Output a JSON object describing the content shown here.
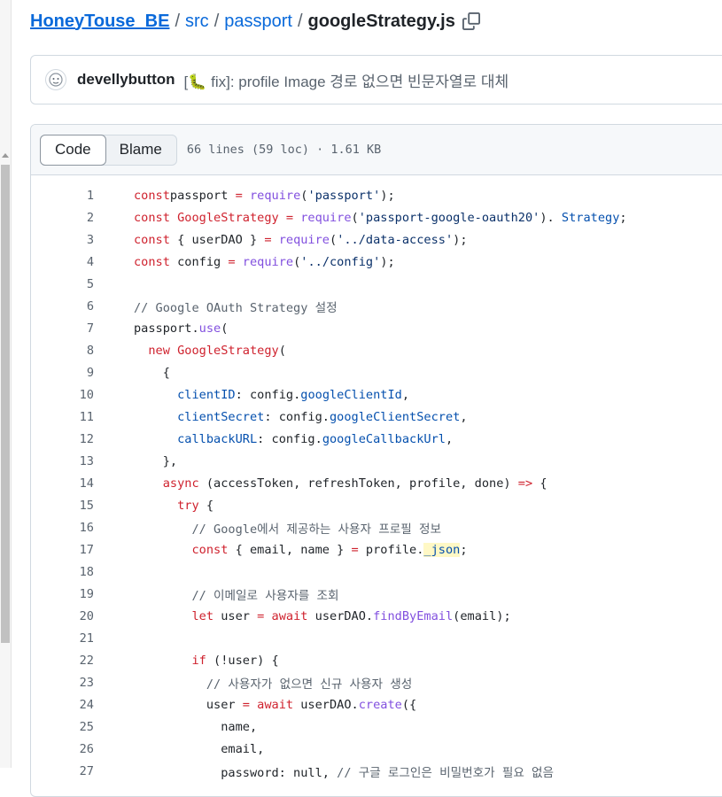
{
  "breadcrumb": {
    "repo": "HoneyTouse_BE",
    "dir1": "src",
    "dir2": "passport",
    "file": "googleStrategy.js",
    "separator": "/"
  },
  "commit": {
    "author": "develly­button",
    "message": "[🐛 fix]: profile Image 경로 없으면 빈문자열로 대체"
  },
  "file_header": {
    "tabs": [
      "Code",
      "Blame"
    ],
    "active_tab": "Code",
    "meta": "66 lines (59 loc) · 1.61 KB"
  },
  "code_lines": [
    {
      "n": "1",
      "tokens": [
        [
          "kw",
          "const"
        ],
        [
          "",
          "passport "
        ],
        [
          "kw",
          "="
        ],
        [
          "",
          ""
        ],
        [
          "fn",
          " require"
        ],
        [
          "",
          "("
        ],
        [
          "str",
          "'passport'"
        ],
        [
          "",
          ");"
        ]
      ]
    },
    {
      "n": "2",
      "tokens": [
        [
          "kw",
          "const"
        ],
        [
          "kw",
          " GoogleStrategy"
        ],
        [
          "",
          ""
        ],
        [
          "kw",
          " ="
        ],
        [
          "fn",
          " require"
        ],
        [
          "",
          "("
        ],
        [
          "str",
          "'passport-google-oauth20'"
        ],
        [
          "",
          "). "
        ],
        [
          "prop",
          "Strategy"
        ],
        [
          "",
          ";"
        ]
      ]
    },
    {
      "n": "3",
      "tokens": [
        [
          "kw",
          "const"
        ],
        [
          "",
          " { userDAO } "
        ],
        [
          "kw",
          "="
        ],
        [
          "fn",
          " require"
        ],
        [
          "",
          "("
        ],
        [
          "str",
          "'../data-access'"
        ],
        [
          "",
          ");"
        ]
      ]
    },
    {
      "n": "4",
      "tokens": [
        [
          "kw",
          "const"
        ],
        [
          "",
          " config "
        ],
        [
          "kw",
          "="
        ],
        [
          "fn",
          " require"
        ],
        [
          "",
          "("
        ],
        [
          "str",
          "'../config'"
        ],
        [
          "",
          ");"
        ]
      ]
    },
    {
      "n": "5",
      "tokens": []
    },
    {
      "n": "6",
      "tokens": [
        [
          "cm",
          "// Google OAuth Strategy 설정"
        ]
      ]
    },
    {
      "n": "7",
      "tokens": [
        [
          "",
          "passport."
        ],
        [
          "fn",
          "use"
        ],
        [
          "",
          "("
        ]
      ]
    },
    {
      "n": "8",
      "tokens": [
        [
          "",
          "  "
        ],
        [
          "kw",
          "new"
        ],
        [
          "kw",
          " GoogleStrategy"
        ],
        [
          "",
          "("
        ]
      ]
    },
    {
      "n": "9",
      "tokens": [
        [
          "",
          "    {"
        ]
      ]
    },
    {
      "n": "10",
      "tokens": [
        [
          "",
          "      "
        ],
        [
          "prop",
          "clientID"
        ],
        [
          "",
          ": config."
        ],
        [
          "prop",
          "googleClientId"
        ],
        [
          "",
          ","
        ]
      ]
    },
    {
      "n": "11",
      "tokens": [
        [
          "",
          "      "
        ],
        [
          "prop",
          "clientSecret"
        ],
        [
          "",
          ": config."
        ],
        [
          "prop",
          "googleClientSecret"
        ],
        [
          "",
          ","
        ]
      ]
    },
    {
      "n": "12",
      "tokens": [
        [
          "",
          "      "
        ],
        [
          "prop",
          "callbackURL"
        ],
        [
          "",
          ": config."
        ],
        [
          "prop",
          "googleCallbackUrl"
        ],
        [
          "",
          ","
        ]
      ]
    },
    {
      "n": "13",
      "tokens": [
        [
          "",
          "    },"
        ]
      ]
    },
    {
      "n": "14",
      "tokens": [
        [
          "",
          "    "
        ],
        [
          "kw",
          "async"
        ],
        [
          "",
          " (accessToken, refreshToken, profile, done) "
        ],
        [
          "kw",
          "=>"
        ],
        [
          "",
          " {"
        ]
      ]
    },
    {
      "n": "15",
      "tokens": [
        [
          "",
          "      "
        ],
        [
          "kw",
          "try"
        ],
        [
          "",
          " {"
        ]
      ]
    },
    {
      "n": "16",
      "tokens": [
        [
          "",
          "        "
        ],
        [
          "cm",
          "// Google에서 제공하는 사용자 프로필 정보"
        ]
      ]
    },
    {
      "n": "17",
      "tokens": [
        [
          "",
          "        "
        ],
        [
          "kw",
          "const"
        ],
        [
          "",
          " { email, name } "
        ],
        [
          "kw",
          "="
        ],
        [
          "",
          " profile."
        ],
        [
          "hlprop",
          "_json"
        ],
        [
          "",
          ";"
        ]
      ]
    },
    {
      "n": "18",
      "tokens": []
    },
    {
      "n": "19",
      "tokens": [
        [
          "",
          "        "
        ],
        [
          "cm",
          "// 이메일로 사용자를 조회"
        ]
      ]
    },
    {
      "n": "20",
      "tokens": [
        [
          "",
          "        "
        ],
        [
          "kw",
          "let"
        ],
        [
          "",
          " user "
        ],
        [
          "kw",
          "="
        ],
        [
          "kw",
          " await"
        ],
        [
          "",
          " userDAO."
        ],
        [
          "fn",
          "findByEmail"
        ],
        [
          "",
          "(email);"
        ]
      ]
    },
    {
      "n": "21",
      "tokens": []
    },
    {
      "n": "22",
      "tokens": [
        [
          "",
          "        "
        ],
        [
          "kw",
          "if"
        ],
        [
          "",
          " (!user) {"
        ]
      ]
    },
    {
      "n": "23",
      "tokens": [
        [
          "",
          "          "
        ],
        [
          "cm",
          "// 사용자가 없으면 신규 사용자 생성"
        ]
      ]
    },
    {
      "n": "24",
      "tokens": [
        [
          "",
          "          user "
        ],
        [
          "kw",
          "="
        ],
        [
          "kw",
          " await"
        ],
        [
          "",
          " userDAO."
        ],
        [
          "fn",
          "create"
        ],
        [
          "",
          "({"
        ]
      ]
    },
    {
      "n": "25",
      "tokens": [
        [
          "",
          "            name,"
        ]
      ]
    },
    {
      "n": "26",
      "tokens": [
        [
          "",
          "            email,"
        ]
      ]
    },
    {
      "n": "27",
      "tokens": [
        [
          "",
          "            password: null, "
        ],
        [
          "cm",
          "// 구글 로그인은 비밀번호가 필요 없음"
        ]
      ]
    }
  ],
  "icons": {
    "copy": "copy-icon",
    "avatar": "avatar"
  }
}
